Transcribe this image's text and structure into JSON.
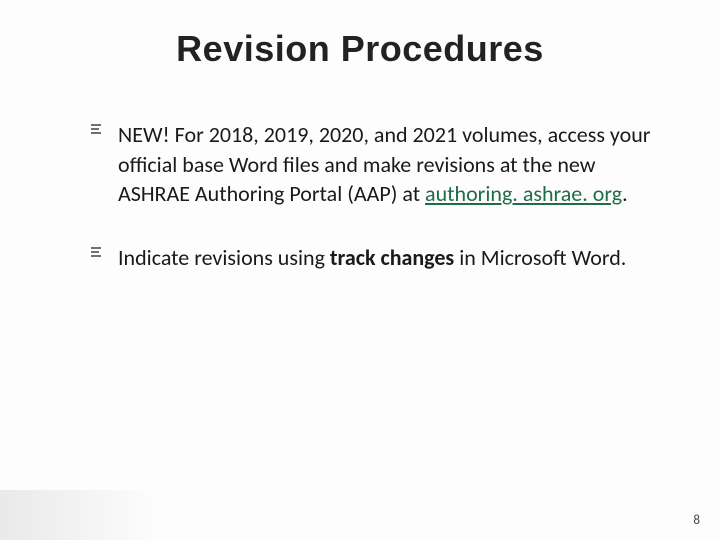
{
  "title": "Revision Procedures",
  "bullets": [
    {
      "prefix": "NEW! ",
      "text_before_link": "For 2018, 2019, 2020, and 2021 volumes, access your official base Word files and make revisions at the new ASHRAE Authoring Portal (AAP) at ",
      "link_text": "authoring. ashrae. org",
      "text_after_link": "."
    },
    {
      "text_before_bold": "Indicate revisions using ",
      "bold_text": "track changes",
      "text_after_bold": " in Microsoft Word."
    }
  ],
  "page_number": "8"
}
